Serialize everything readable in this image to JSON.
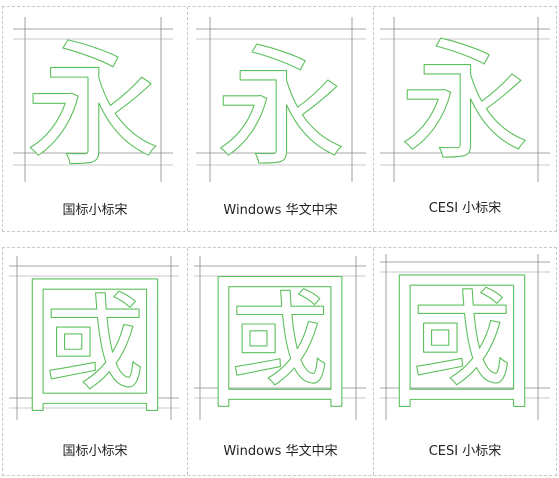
{
  "rows": [
    {
      "glyph": "永",
      "cells": [
        {
          "font_label": "国标小标宋"
        },
        {
          "font_label": "Windows 华文中宋"
        },
        {
          "font_label": "CESI 小标宋"
        }
      ]
    },
    {
      "glyph": "國",
      "cells": [
        {
          "font_label": "国标小标宋"
        },
        {
          "font_label": "Windows 华文中宋"
        },
        {
          "font_label": "CESI 小标宋"
        }
      ]
    }
  ],
  "colors": {
    "glyph_outline": "#5cc05c",
    "guide_lines": "#8a8a8a",
    "panel_border": "#c8c8c8"
  }
}
